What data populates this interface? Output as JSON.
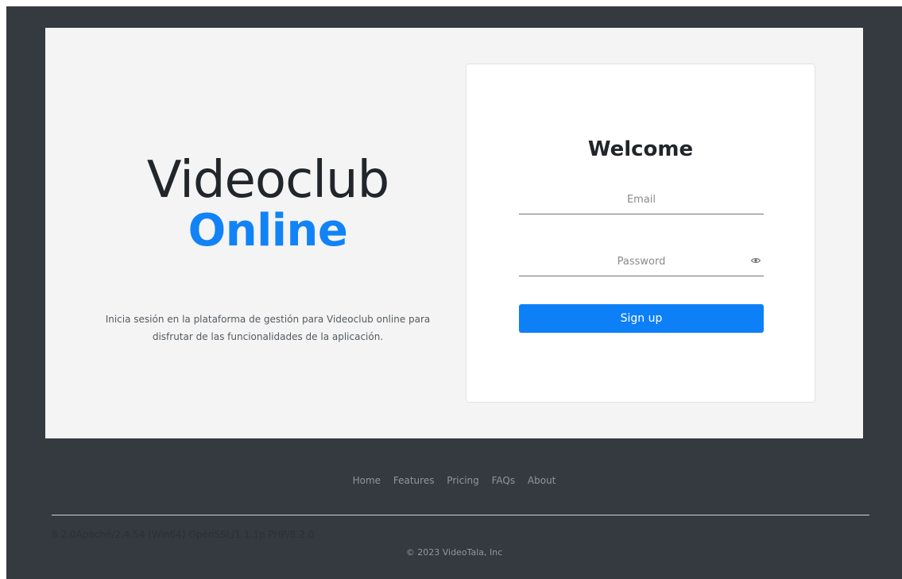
{
  "brand": {
    "line1": "Videoclub",
    "line2": "Online"
  },
  "tagline": {
    "line1": "Inicia sesión en la plataforma de gestión para Videoclub online para",
    "line2": "disfrutar de las funcionalidades de la aplicación."
  },
  "login": {
    "title": "Welcome",
    "email_placeholder": "Email",
    "password_placeholder": "Password",
    "submit_label": "Sign up",
    "password_toggle_icon": "eye-icon"
  },
  "footer": {
    "nav": [
      "Home",
      "Features",
      "Pricing",
      "FAQs",
      "About"
    ],
    "server_info": "8.2.0Apache/2.4.54 (Win64) OpenSSL/1.1.1p PHP/8.2.0",
    "copyright": "© 2023 VideoTala, Inc"
  },
  "colors": {
    "frame": "#343a40",
    "panel": "#f4f4f4",
    "accent": "#0d80f8",
    "brand_accent": "#1183f6",
    "heading": "#212529"
  }
}
